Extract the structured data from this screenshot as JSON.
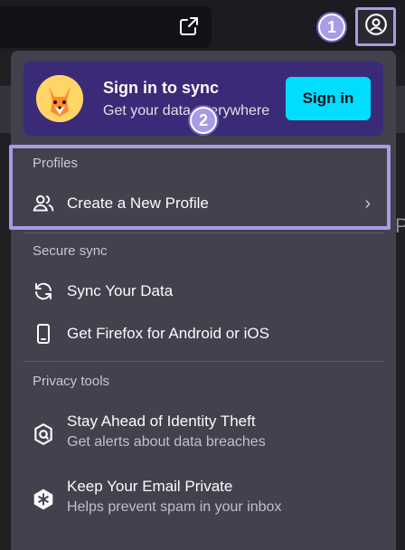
{
  "toolbar": {
    "share_icon": "share-icon",
    "account_icon": "account-icon"
  },
  "steps": {
    "one": "1",
    "two": "2"
  },
  "sync": {
    "title": "Sign in to sync",
    "subtitle": "Get your data everywhere",
    "button": "Sign in",
    "avatar_icon": "fox-avatar"
  },
  "profiles": {
    "label": "Profiles",
    "create_label": "Create a New Profile",
    "icon": "users-icon"
  },
  "secure_sync": {
    "label": "Secure sync",
    "items": [
      {
        "label": "Sync Your Data",
        "icon": "sync-icon"
      },
      {
        "label": "Get Firefox for Android or iOS",
        "icon": "phone-icon"
      }
    ]
  },
  "privacy_tools": {
    "label": "Privacy tools",
    "items": [
      {
        "label": "Stay Ahead of Identity Theft",
        "sub": "Get alerts about data breaches",
        "icon": "monitor-icon"
      },
      {
        "label": "Keep Your Email Private",
        "sub": "Helps prevent spam in your inbox",
        "icon": "relay-icon"
      }
    ]
  },
  "colors": {
    "accent": "#00ddff",
    "highlight": "#a99be4",
    "panel": "#42414d",
    "sync_card": "#3b2a78"
  }
}
